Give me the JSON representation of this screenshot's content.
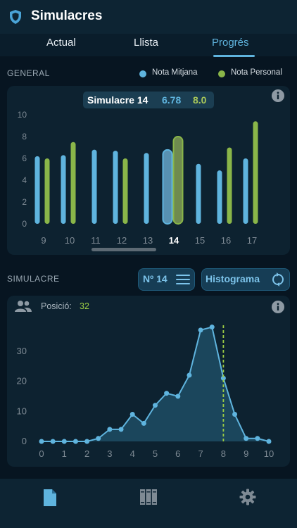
{
  "app": {
    "title": "Simulacres"
  },
  "tabs": [
    {
      "label": "Actual",
      "active": false
    },
    {
      "label": "Llista",
      "active": false
    },
    {
      "label": "Progrés",
      "active": true
    }
  ],
  "general": {
    "section_label": "GENERAL",
    "legend": [
      {
        "label": "Nota Mitjana",
        "color": "#5fb4de"
      },
      {
        "label": "Nota Personal",
        "color": "#8ab649"
      }
    ],
    "selected": {
      "label": "Simulacre 14",
      "mitjana": "6.78",
      "personal": "8.0"
    }
  },
  "simulacre": {
    "section_label": "SIMULACRE",
    "number_button": "Nº 14",
    "histogram_button": "Histograma",
    "position_label": "Posició:",
    "position_value": "32"
  },
  "colors": {
    "accent": "#5fb4de",
    "personal": "#8ab649",
    "position_line": "#9ccc44"
  },
  "icons": {
    "logo": "shield-icon",
    "info": "info-icon",
    "users": "users-icon",
    "menu": "menu-icon",
    "refresh": "refresh-icon",
    "document": "document-icon",
    "library": "library-icon",
    "settings": "gear-icon"
  },
  "chart_data": [
    {
      "type": "bar",
      "categories": [
        "9",
        "10",
        "11",
        "12",
        "13",
        "14",
        "15",
        "16",
        "17"
      ],
      "selected_category": "14",
      "series": [
        {
          "name": "Nota Mitjana",
          "values": [
            6.2,
            6.3,
            6.8,
            6.7,
            6.5,
            6.78,
            5.5,
            4.9,
            6.0
          ]
        },
        {
          "name": "Nota Personal",
          "values": [
            6.0,
            7.5,
            null,
            6.0,
            null,
            8.0,
            null,
            7.0,
            9.4
          ]
        }
      ],
      "yticks": [
        0,
        2,
        4,
        6,
        8,
        10
      ],
      "ylim": [
        0,
        10
      ]
    },
    {
      "type": "area",
      "x": [
        0,
        0.5,
        1,
        1.5,
        2,
        2.5,
        3,
        3.5,
        4,
        4.5,
        5,
        5.5,
        6,
        6.5,
        7,
        7.5,
        8,
        8.5,
        9,
        9.5,
        10
      ],
      "values": [
        0,
        0,
        0,
        0,
        0,
        1,
        4,
        4,
        9,
        6,
        12,
        16,
        15,
        22,
        37,
        38,
        21,
        9,
        1,
        1,
        0
      ],
      "xticks": [
        0,
        1,
        2,
        3,
        4,
        5,
        6,
        7,
        8,
        9,
        10
      ],
      "yticks": [
        0,
        10,
        20,
        30
      ],
      "xlim": [
        0,
        10
      ],
      "ylim": [
        0,
        40
      ],
      "marker_x": 8.0
    }
  ]
}
